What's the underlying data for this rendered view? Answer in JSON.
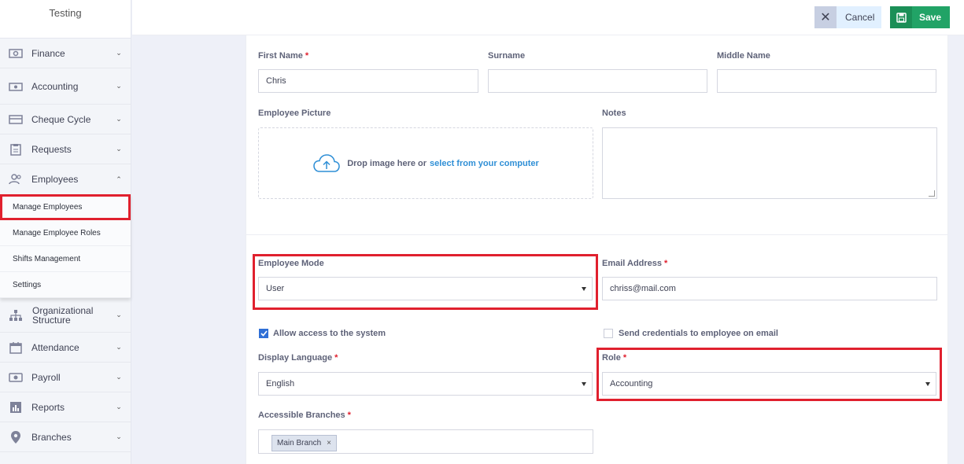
{
  "sidebar": {
    "brand": "Testing",
    "items": [
      {
        "label": "Finance",
        "icon": "cash-icon"
      },
      {
        "label": "Accounting",
        "icon": "money-icon"
      },
      {
        "label": "Cheque Cycle",
        "icon": "cheque-icon"
      },
      {
        "label": "Requests",
        "icon": "clipboard-icon"
      },
      {
        "label": "Employees",
        "icon": "users-icon"
      },
      {
        "label": "Organizational Structure",
        "icon": "org-chart-icon"
      },
      {
        "label": "Attendance",
        "icon": "calendar-icon"
      },
      {
        "label": "Payroll",
        "icon": "payroll-icon"
      },
      {
        "label": "Reports",
        "icon": "bar-chart-icon"
      },
      {
        "label": "Branches",
        "icon": "map-pin-icon"
      }
    ],
    "employees_submenu": [
      {
        "label": "Manage Employees",
        "active": true
      },
      {
        "label": "Manage Employee Roles"
      },
      {
        "label": "Shifts Management"
      },
      {
        "label": "Settings"
      }
    ]
  },
  "toolbar": {
    "cancel_label": "Cancel",
    "save_label": "Save"
  },
  "form": {
    "first_name": {
      "label": "First Name",
      "value": "Chris"
    },
    "surname": {
      "label": "Surname",
      "value": ""
    },
    "middle_name": {
      "label": "Middle Name",
      "value": ""
    },
    "employee_picture": {
      "label": "Employee Picture",
      "drop_text": "Drop image here or",
      "link_text": "select from your computer"
    },
    "notes": {
      "label": "Notes",
      "value": ""
    },
    "employee_mode": {
      "label": "Employee Mode",
      "value": "User"
    },
    "email": {
      "label": "Email Address",
      "value": "chriss@mail.com"
    },
    "allow_access": {
      "label": "Allow access to the system",
      "checked": true
    },
    "send_credentials": {
      "label": "Send credentials to employee on email",
      "checked": false
    },
    "display_language": {
      "label": "Display Language",
      "value": "English"
    },
    "role": {
      "label": "Role",
      "value": "Accounting"
    },
    "accessible_branches": {
      "label": "Accessible Branches",
      "tags": [
        "Main Branch"
      ],
      "remove_glyph": "×"
    },
    "required_mark": "*"
  },
  "colors": {
    "highlight": "#e0202e",
    "save": "#21a366",
    "link": "#2f8fd6"
  }
}
